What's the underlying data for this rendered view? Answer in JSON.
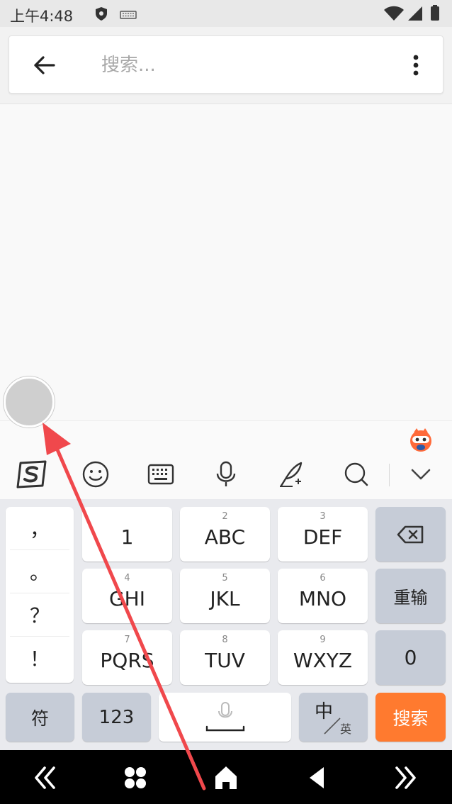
{
  "status": {
    "time": "上午4:48"
  },
  "search": {
    "placeholder": "搜索..."
  },
  "keyboard": {
    "toolbar": [
      "sogou-logo-icon",
      "emoji-icon",
      "keyboard-icon",
      "microphone-icon",
      "handwriting-icon",
      "search-icon",
      "collapse-icon"
    ],
    "punctuation": [
      "，",
      "。",
      "？",
      "！"
    ],
    "keys": {
      "k1": {
        "label": "1"
      },
      "k2": {
        "num": "2",
        "label": "ABC"
      },
      "k3": {
        "num": "3",
        "label": "DEF"
      },
      "k4": {
        "num": "4",
        "label": "GHI"
      },
      "k5": {
        "num": "5",
        "label": "JKL"
      },
      "k6": {
        "num": "6",
        "label": "MNO"
      },
      "k7": {
        "num": "7",
        "label": "PQRS"
      },
      "k8": {
        "num": "8",
        "label": "TUV"
      },
      "k9": {
        "num": "9",
        "label": "WXYZ"
      },
      "retype": "重输",
      "zero": "0",
      "symbol": "符",
      "num123": "123",
      "lang_main": "中",
      "lang_sub": "英",
      "search": "搜索"
    }
  },
  "colors": {
    "accent": "#ff7a2f",
    "arrow": "#f0484c"
  }
}
